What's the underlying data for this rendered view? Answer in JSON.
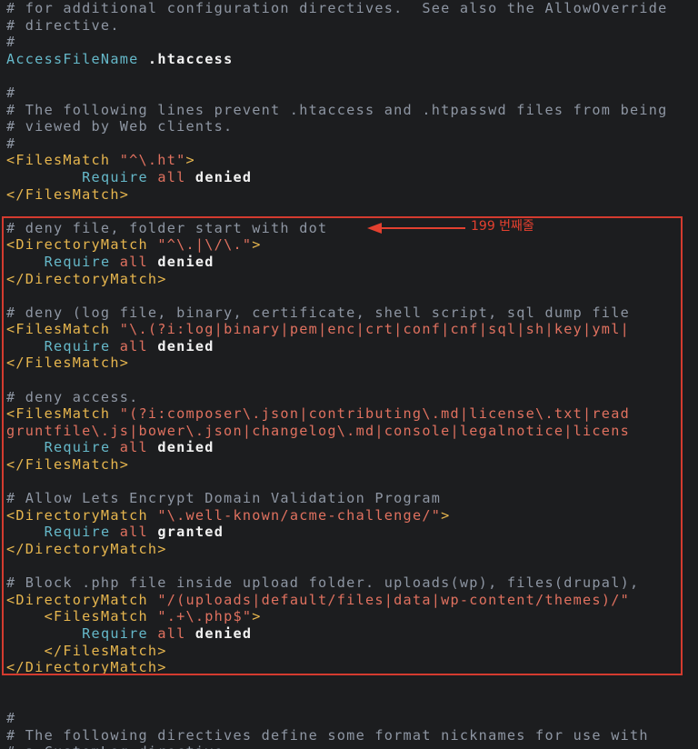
{
  "lines": [
    [
      [
        "c",
        "# for additional configuration directives.  See also the AllowOverride"
      ]
    ],
    [
      [
        "c",
        "# directive."
      ]
    ],
    [
      [
        "c",
        "#"
      ]
    ],
    [
      [
        "k",
        "AccessFileName"
      ],
      [
        "p",
        " "
      ],
      [
        "v",
        ".htaccess"
      ]
    ],
    [
      [
        "p",
        ""
      ]
    ],
    [
      [
        "c",
        "#"
      ]
    ],
    [
      [
        "c",
        "# The following lines prevent .htaccess and .htpasswd files from being"
      ]
    ],
    [
      [
        "c",
        "# viewed by Web clients."
      ]
    ],
    [
      [
        "c",
        "#"
      ]
    ],
    [
      [
        "t",
        "<FilesMatch "
      ],
      [
        "s",
        "\"^\\.ht\""
      ],
      [
        "t",
        ">"
      ]
    ],
    [
      [
        "p",
        "        "
      ],
      [
        "k",
        "Require"
      ],
      [
        "p",
        " "
      ],
      [
        "a",
        "all"
      ],
      [
        "p",
        " "
      ],
      [
        "v",
        "denied"
      ]
    ],
    [
      [
        "t",
        "</FilesMatch>"
      ]
    ],
    [
      [
        "p",
        ""
      ]
    ],
    [
      [
        "c",
        "# deny file, folder start with dot"
      ]
    ],
    [
      [
        "t",
        "<DirectoryMatch "
      ],
      [
        "s",
        "\"^\\.|\\/\\.\""
      ],
      [
        "t",
        ">"
      ]
    ],
    [
      [
        "p",
        "    "
      ],
      [
        "k",
        "Require"
      ],
      [
        "p",
        " "
      ],
      [
        "a",
        "all"
      ],
      [
        "p",
        " "
      ],
      [
        "v",
        "denied"
      ]
    ],
    [
      [
        "t",
        "</DirectoryMatch>"
      ]
    ],
    [
      [
        "p",
        ""
      ]
    ],
    [
      [
        "c",
        "# deny (log file, binary, certificate, shell script, sql dump file"
      ]
    ],
    [
      [
        "t",
        "<FilesMatch "
      ],
      [
        "s",
        "\"\\.(?i:log|binary|pem|enc|crt|conf|cnf|sql|sh|key|yml|"
      ]
    ],
    [
      [
        "p",
        "    "
      ],
      [
        "k",
        "Require"
      ],
      [
        "p",
        " "
      ],
      [
        "a",
        "all"
      ],
      [
        "p",
        " "
      ],
      [
        "v",
        "denied"
      ]
    ],
    [
      [
        "t",
        "</FilesMatch>"
      ]
    ],
    [
      [
        "p",
        ""
      ]
    ],
    [
      [
        "c",
        "# deny access."
      ]
    ],
    [
      [
        "t",
        "<FilesMatch "
      ],
      [
        "s",
        "\"(?i:composer\\.json|contributing\\.md|license\\.txt|read"
      ]
    ],
    [
      [
        "s",
        "gruntfile\\.js|bower\\.json|changelog\\.md|console|legalnotice|licens"
      ]
    ],
    [
      [
        "p",
        "    "
      ],
      [
        "k",
        "Require"
      ],
      [
        "p",
        " "
      ],
      [
        "a",
        "all"
      ],
      [
        "p",
        " "
      ],
      [
        "v",
        "denied"
      ]
    ],
    [
      [
        "t",
        "</FilesMatch>"
      ]
    ],
    [
      [
        "p",
        ""
      ]
    ],
    [
      [
        "c",
        "# Allow Lets Encrypt Domain Validation Program"
      ]
    ],
    [
      [
        "t",
        "<DirectoryMatch "
      ],
      [
        "s",
        "\"\\.well-known/acme-challenge/\""
      ],
      [
        "t",
        ">"
      ]
    ],
    [
      [
        "p",
        "    "
      ],
      [
        "k",
        "Require"
      ],
      [
        "p",
        " "
      ],
      [
        "a",
        "all"
      ],
      [
        "p",
        " "
      ],
      [
        "v",
        "granted"
      ]
    ],
    [
      [
        "t",
        "</DirectoryMatch>"
      ]
    ],
    [
      [
        "p",
        ""
      ]
    ],
    [
      [
        "c",
        "# Block .php file inside upload folder. uploads(wp), files(drupal),"
      ]
    ],
    [
      [
        "t",
        "<DirectoryMatch "
      ],
      [
        "s",
        "\"/(uploads|default/files|data|wp-content/themes)/\""
      ]
    ],
    [
      [
        "p",
        "    "
      ],
      [
        "t",
        "<FilesMatch "
      ],
      [
        "s",
        "\".+\\.php$\""
      ],
      [
        "t",
        ">"
      ]
    ],
    [
      [
        "p",
        "        "
      ],
      [
        "k",
        "Require"
      ],
      [
        "p",
        " "
      ],
      [
        "a",
        "all"
      ],
      [
        "p",
        " "
      ],
      [
        "v",
        "denied"
      ]
    ],
    [
      [
        "p",
        "    "
      ],
      [
        "t",
        "</FilesMatch>"
      ]
    ],
    [
      [
        "t",
        "</DirectoryMatch>"
      ]
    ],
    [
      [
        "p",
        ""
      ]
    ],
    [
      [
        "p",
        ""
      ]
    ],
    [
      [
        "c",
        "#"
      ]
    ],
    [
      [
        "c",
        "# The following directives define some format nicknames for use with"
      ]
    ],
    [
      [
        "c",
        "# a CustomLog directive."
      ]
    ]
  ],
  "annotation": {
    "text": "199 번째줄",
    "color": "#e3402f"
  },
  "colors": {
    "background": "#1c1d1f",
    "comment": "#8e96a3",
    "keyword": "#65b8c9",
    "tag": "#e7b64e",
    "string": "#e0715f",
    "highlight_border": "#d43b2f"
  }
}
